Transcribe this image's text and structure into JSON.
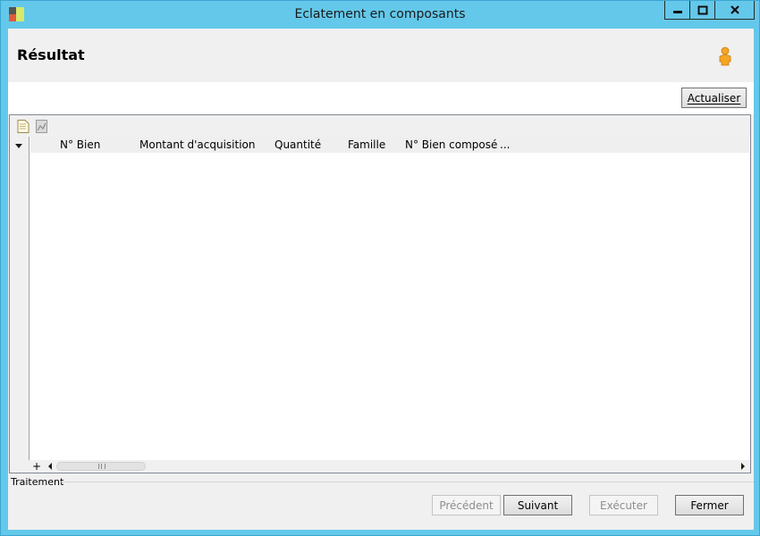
{
  "window": {
    "title": "Eclatement en composants",
    "controls": {
      "minimize": "—",
      "maximize": "□",
      "close": "✕"
    }
  },
  "header": {
    "title": "Résultat",
    "user_icon": "user-icon"
  },
  "actions": {
    "refresh_label": "Actualiser"
  },
  "grid": {
    "toolbar_icons": [
      "document-icon",
      "image-icon"
    ],
    "columns": [
      "N° Bien",
      "Montant d'acquisition",
      "Quantité",
      "Famille",
      "N° Bien composé",
      "..."
    ],
    "rows": [],
    "add_row_label": "+",
    "scroll_grip": "|||"
  },
  "footer": {
    "group_label": "Traitement",
    "buttons": {
      "previous": "Précédent",
      "next": "Suivant",
      "execute": "Exécuter",
      "close": "Fermer"
    }
  },
  "colors": {
    "titlebar": "#64c8ea",
    "user_icon": "#f5a623"
  }
}
